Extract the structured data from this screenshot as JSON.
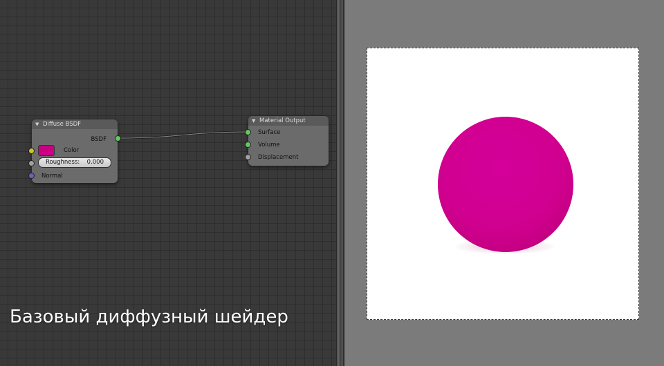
{
  "node_editor": {
    "diffuse_node": {
      "title": "Diffuse BSDF",
      "output_label": "BSDF",
      "color_label": "Color",
      "color_value": "#c90083",
      "roughness_label": "Roughness:",
      "roughness_value": "0.000",
      "normal_label": "Normal"
    },
    "output_node": {
      "title": "Material Output",
      "surface_label": "Surface",
      "volume_label": "Volume",
      "displacement_label": "Displacement"
    },
    "socket_colors": {
      "shader": "#63c763",
      "color": "#c7c729",
      "float": "#a1a1a1",
      "vector": "#6363c7"
    }
  },
  "render_preview": {
    "sphere_color": "#d0008f",
    "background": "#ffffff"
  },
  "caption": "Базовый диффузный шейдер"
}
